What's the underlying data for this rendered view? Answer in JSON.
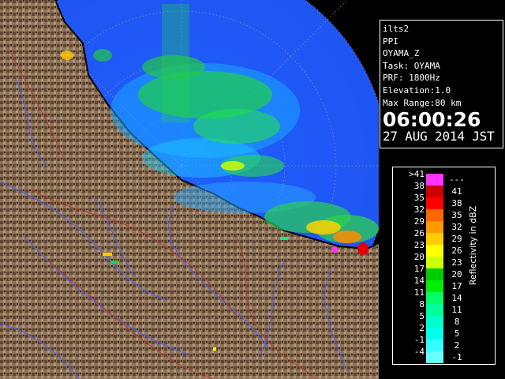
{
  "info": {
    "radar_id": "ilts2",
    "mode": "PPI",
    "product": "OYAMA_Z",
    "task": "Task: OYAMA",
    "prf": "PRF: 1800Hz",
    "elevation": "Elevation:1.0",
    "max_range": "Max Range:80 km",
    "time": "06:00:26",
    "date": "27 AUG 2014 JST"
  },
  "legend": {
    "title": "Reflectivity in dBZ",
    "rows": [
      {
        "low": ">41",
        "high": "---",
        "color": "#ff33ff"
      },
      {
        "low": "38",
        "high": "41",
        "color": "#cc0000"
      },
      {
        "low": "35",
        "high": "38",
        "color": "#ff0000"
      },
      {
        "low": "32",
        "high": "35",
        "color": "#ff6600"
      },
      {
        "low": "29",
        "high": "32",
        "color": "#ff9900"
      },
      {
        "low": "26",
        "high": "29",
        "color": "#ffcc00"
      },
      {
        "low": "23",
        "high": "26",
        "color": "#ffff00"
      },
      {
        "low": "20",
        "high": "23",
        "color": "#ccff00"
      },
      {
        "low": "17",
        "high": "20",
        "color": "#00cc00"
      },
      {
        "low": "14",
        "high": "17",
        "color": "#00ee00"
      },
      {
        "low": "11",
        "high": "14",
        "color": "#00ff66"
      },
      {
        "low": "8",
        "high": "11",
        "color": "#00ff99"
      },
      {
        "low": "5",
        "high": "8",
        "color": "#00ffcc"
      },
      {
        "low": "2",
        "high": "5",
        "color": "#00ffee"
      },
      {
        "low": "-1",
        "high": "2",
        "color": "#33ffff"
      },
      {
        "low": "-4",
        "high": "-1",
        "color": "#66ffff"
      }
    ]
  },
  "map": {
    "sea_color": "#1f62ff",
    "land_color": "#8a7058",
    "coast_color": "#000000"
  }
}
